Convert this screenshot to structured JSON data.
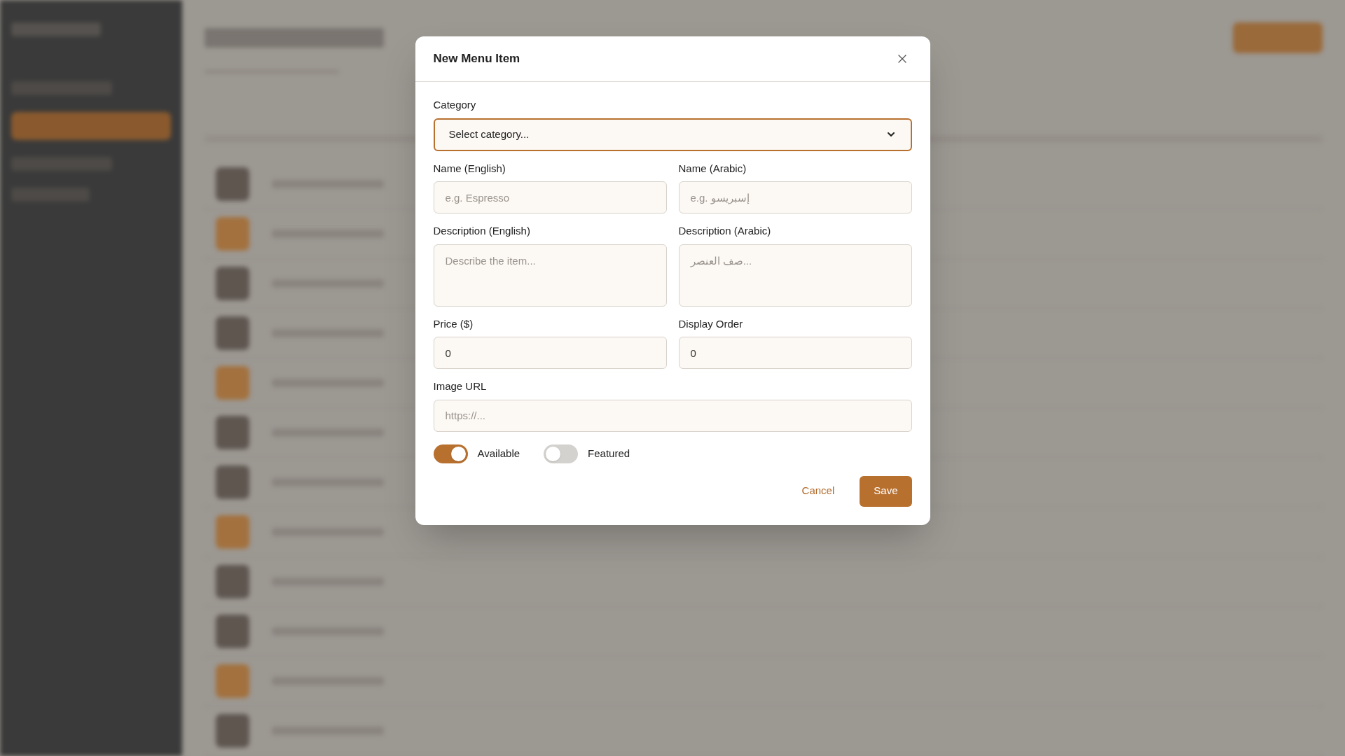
{
  "dialog": {
    "title": "New Menu Item",
    "rows": [
      [
        {
          "kind": "select",
          "label": "Category",
          "value": "Select category...",
          "focused": true
        }
      ],
      [
        {
          "kind": "text",
          "label": "Name (English)",
          "placeholder": "e.g. Espresso"
        },
        {
          "kind": "text",
          "label": "Name (Arabic)",
          "placeholder": "e.g. إسبريسو"
        }
      ],
      [
        {
          "kind": "textarea",
          "label": "Description (English)",
          "placeholder": "Describe the item..."
        },
        {
          "kind": "textarea",
          "label": "Description (Arabic)",
          "placeholder": "صف العنصر..."
        }
      ],
      [
        {
          "kind": "text",
          "label": "Price ($)",
          "value": "0"
        },
        {
          "kind": "text",
          "label": "Display Order",
          "value": "0"
        }
      ],
      [
        {
          "kind": "text",
          "label": "Image URL",
          "placeholder": "https://..."
        }
      ]
    ],
    "toggles": [
      {
        "label": "Available",
        "on": true
      },
      {
        "label": "Featured",
        "on": false
      }
    ],
    "buttons": [
      {
        "kind": "text",
        "label": "Cancel"
      },
      {
        "kind": "primary",
        "label": "Save"
      }
    ]
  }
}
